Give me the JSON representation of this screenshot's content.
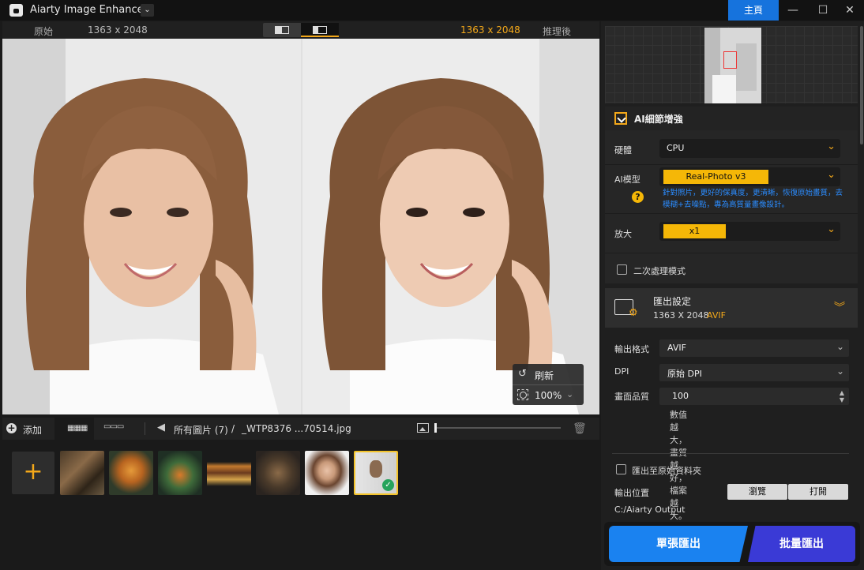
{
  "app": {
    "title": "Aiarty Image Enhancer",
    "home_label": "主頁"
  },
  "compare": {
    "original_label": "原始",
    "original_res": "1363 x 2048",
    "result_res": "1363 x 2048",
    "after_label": "推理後"
  },
  "preview": {
    "refresh_label": "刷新",
    "zoom": "100%"
  },
  "bottombar": {
    "add_label": "添加",
    "all_images": "所有圖片 (7)",
    "separator": "/",
    "filename": "_WTP8376 ...70514.jpg"
  },
  "thumbnails": [
    {
      "name": "butterfly",
      "selected": false
    },
    {
      "name": "tiger",
      "selected": false
    },
    {
      "name": "plant",
      "selected": false
    },
    {
      "name": "burger",
      "selected": false
    },
    {
      "name": "dog",
      "selected": false
    },
    {
      "name": "portrait-woman",
      "selected": false
    },
    {
      "name": "current-photo",
      "selected": true
    }
  ],
  "ai_enhance": {
    "title": "AI細節增強",
    "hardware_label": "硬體",
    "hardware_value": "CPU",
    "model_label": "AI模型",
    "model_value": "Real-Photo  v3",
    "model_desc": "針對照片，更好的保真度，更清晰，恢復原始畫質，去模糊+去噪點，專為高質量畫像設計。",
    "scale_label": "放大",
    "scale_value": "x1",
    "second_pass_label": "二次處理模式"
  },
  "export": {
    "title": "匯出設定",
    "resolution": "1363 X 2048",
    "format_badge": "AVIF",
    "format_label": "輸出格式",
    "format_value": "AVIF",
    "dpi_label": "DPI",
    "dpi_value": "原始 DPI",
    "quality_label": "畫面品質",
    "quality_value": "100",
    "quality_note": "數值越大，畫質越好，檔案越大。",
    "save_original_label": "匯出至原始資料夾",
    "output_location_label": "輸出位置",
    "browse_label": "瀏覽",
    "open_label": "打開",
    "output_path": "C:/Aiarty Output",
    "single_export": "單張匯出",
    "batch_export": "批量匯出"
  },
  "colors": {
    "accent": "#f3a81a",
    "primary_blue": "#1673dd",
    "batch_purple": "#3a3ad6",
    "model_yellow": "#f5b707"
  }
}
